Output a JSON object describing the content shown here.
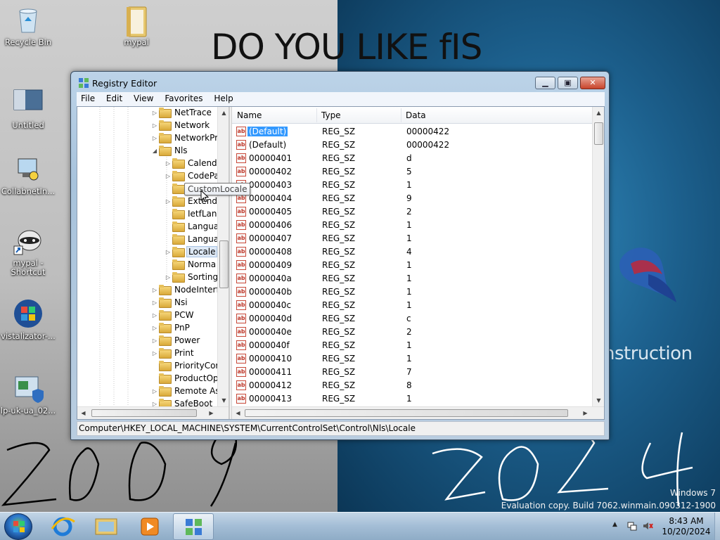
{
  "desktop": {
    "headline": "DO YOU LIKE fIS",
    "construction_text": "nstruction",
    "watermark_line1": "Windows 7",
    "watermark_line2": "Evaluation copy. Build 7062.winmain.090312-1900",
    "icons": [
      {
        "label": "Recycle Bin",
        "icon": "recycle-bin-icon"
      },
      {
        "label": "mypal",
        "icon": "folder-icon"
      },
      {
        "label": "Untitled",
        "icon": "window-icon"
      },
      {
        "label": "CollabnetIn...",
        "icon": "computer-installer-icon"
      },
      {
        "label": "mypal - Shortcut",
        "icon": "raccoon-shortcut-icon"
      },
      {
        "label": "vistalizator-...",
        "icon": "windows-logo-icon"
      },
      {
        "label": "lp-uk-ua_02...",
        "icon": "installer-shield-icon"
      }
    ]
  },
  "window": {
    "title": "Registry Editor",
    "menu": [
      "File",
      "Edit",
      "View",
      "Favorites",
      "Help"
    ],
    "tree": [
      {
        "label": "NetTrace",
        "level": 0,
        "expander": "▷"
      },
      {
        "label": "Network",
        "level": 0,
        "expander": "▷"
      },
      {
        "label": "NetworkPr",
        "level": 0,
        "expander": "▷"
      },
      {
        "label": "Nls",
        "level": 0,
        "expander": "◢"
      },
      {
        "label": "Calend",
        "level": 1,
        "expander": "▷"
      },
      {
        "label": "CodePa",
        "level": 1,
        "expander": "▷"
      },
      {
        "label": "CustomLocale",
        "level": 1,
        "expander": ""
      },
      {
        "label": "Extende",
        "level": 1,
        "expander": "▷"
      },
      {
        "label": "IetfLang",
        "level": 1,
        "expander": ""
      },
      {
        "label": "Langua",
        "level": 1,
        "expander": ""
      },
      {
        "label": "Langua",
        "level": 1,
        "expander": ""
      },
      {
        "label": "Locale",
        "level": 1,
        "expander": "▷",
        "selected": true
      },
      {
        "label": "Norma",
        "level": 1,
        "expander": ""
      },
      {
        "label": "Sorting",
        "level": 1,
        "expander": "▷"
      },
      {
        "label": "NodeInterf",
        "level": 0,
        "expander": "▷"
      },
      {
        "label": "Nsi",
        "level": 0,
        "expander": "▷"
      },
      {
        "label": "PCW",
        "level": 0,
        "expander": "▷"
      },
      {
        "label": "PnP",
        "level": 0,
        "expander": "▷"
      },
      {
        "label": "Power",
        "level": 0,
        "expander": "▷"
      },
      {
        "label": "Print",
        "level": 0,
        "expander": "▷"
      },
      {
        "label": "PriorityCor",
        "level": 0,
        "expander": ""
      },
      {
        "label": "ProductOp",
        "level": 0,
        "expander": ""
      },
      {
        "label": "Remote As",
        "level": 0,
        "expander": "▷"
      },
      {
        "label": "SafeBoot",
        "level": 0,
        "expander": "▷"
      }
    ],
    "tooltip": "CustomLocale",
    "columns": {
      "name": "Name",
      "type": "Type",
      "data": "Data"
    },
    "values": [
      {
        "name": "(Default)",
        "type": "REG_SZ",
        "data": "00000422",
        "selected": true
      },
      {
        "name": "(Default)",
        "type": "REG_SZ",
        "data": "00000422"
      },
      {
        "name": "00000401",
        "type": "REG_SZ",
        "data": "d"
      },
      {
        "name": "00000402",
        "type": "REG_SZ",
        "data": "5"
      },
      {
        "name": "00000403",
        "type": "REG_SZ",
        "data": "1"
      },
      {
        "name": "00000404",
        "type": "REG_SZ",
        "data": "9"
      },
      {
        "name": "00000405",
        "type": "REG_SZ",
        "data": "2"
      },
      {
        "name": "00000406",
        "type": "REG_SZ",
        "data": "1"
      },
      {
        "name": "00000407",
        "type": "REG_SZ",
        "data": "1"
      },
      {
        "name": "00000408",
        "type": "REG_SZ",
        "data": "4"
      },
      {
        "name": "00000409",
        "type": "REG_SZ",
        "data": "1"
      },
      {
        "name": "0000040a",
        "type": "REG_SZ",
        "data": "1"
      },
      {
        "name": "0000040b",
        "type": "REG_SZ",
        "data": "1"
      },
      {
        "name": "0000040c",
        "type": "REG_SZ",
        "data": "1"
      },
      {
        "name": "0000040d",
        "type": "REG_SZ",
        "data": "c"
      },
      {
        "name": "0000040e",
        "type": "REG_SZ",
        "data": "2"
      },
      {
        "name": "0000040f",
        "type": "REG_SZ",
        "data": "1"
      },
      {
        "name": "00000410",
        "type": "REG_SZ",
        "data": "1"
      },
      {
        "name": "00000411",
        "type": "REG_SZ",
        "data": "7"
      },
      {
        "name": "00000412",
        "type": "REG_SZ",
        "data": "8"
      },
      {
        "name": "00000413",
        "type": "REG_SZ",
        "data": "1"
      }
    ],
    "status_path": "Computer\\HKEY_LOCAL_MACHINE\\SYSTEM\\CurrentControlSet\\Control\\Nls\\Locale",
    "ab_glyph": "ab"
  },
  "taskbar": {
    "time": "8:43 AM",
    "date": "10/20/2024",
    "buttons": [
      "start-orb-icon",
      "internet-explorer-icon",
      "explorer-icon",
      "media-player-icon",
      "registry-editor-icon"
    ]
  },
  "colors": {
    "selection": "#3399ff",
    "close_button": "#c8442b",
    "desktop_blue": "#1c5f8c"
  }
}
